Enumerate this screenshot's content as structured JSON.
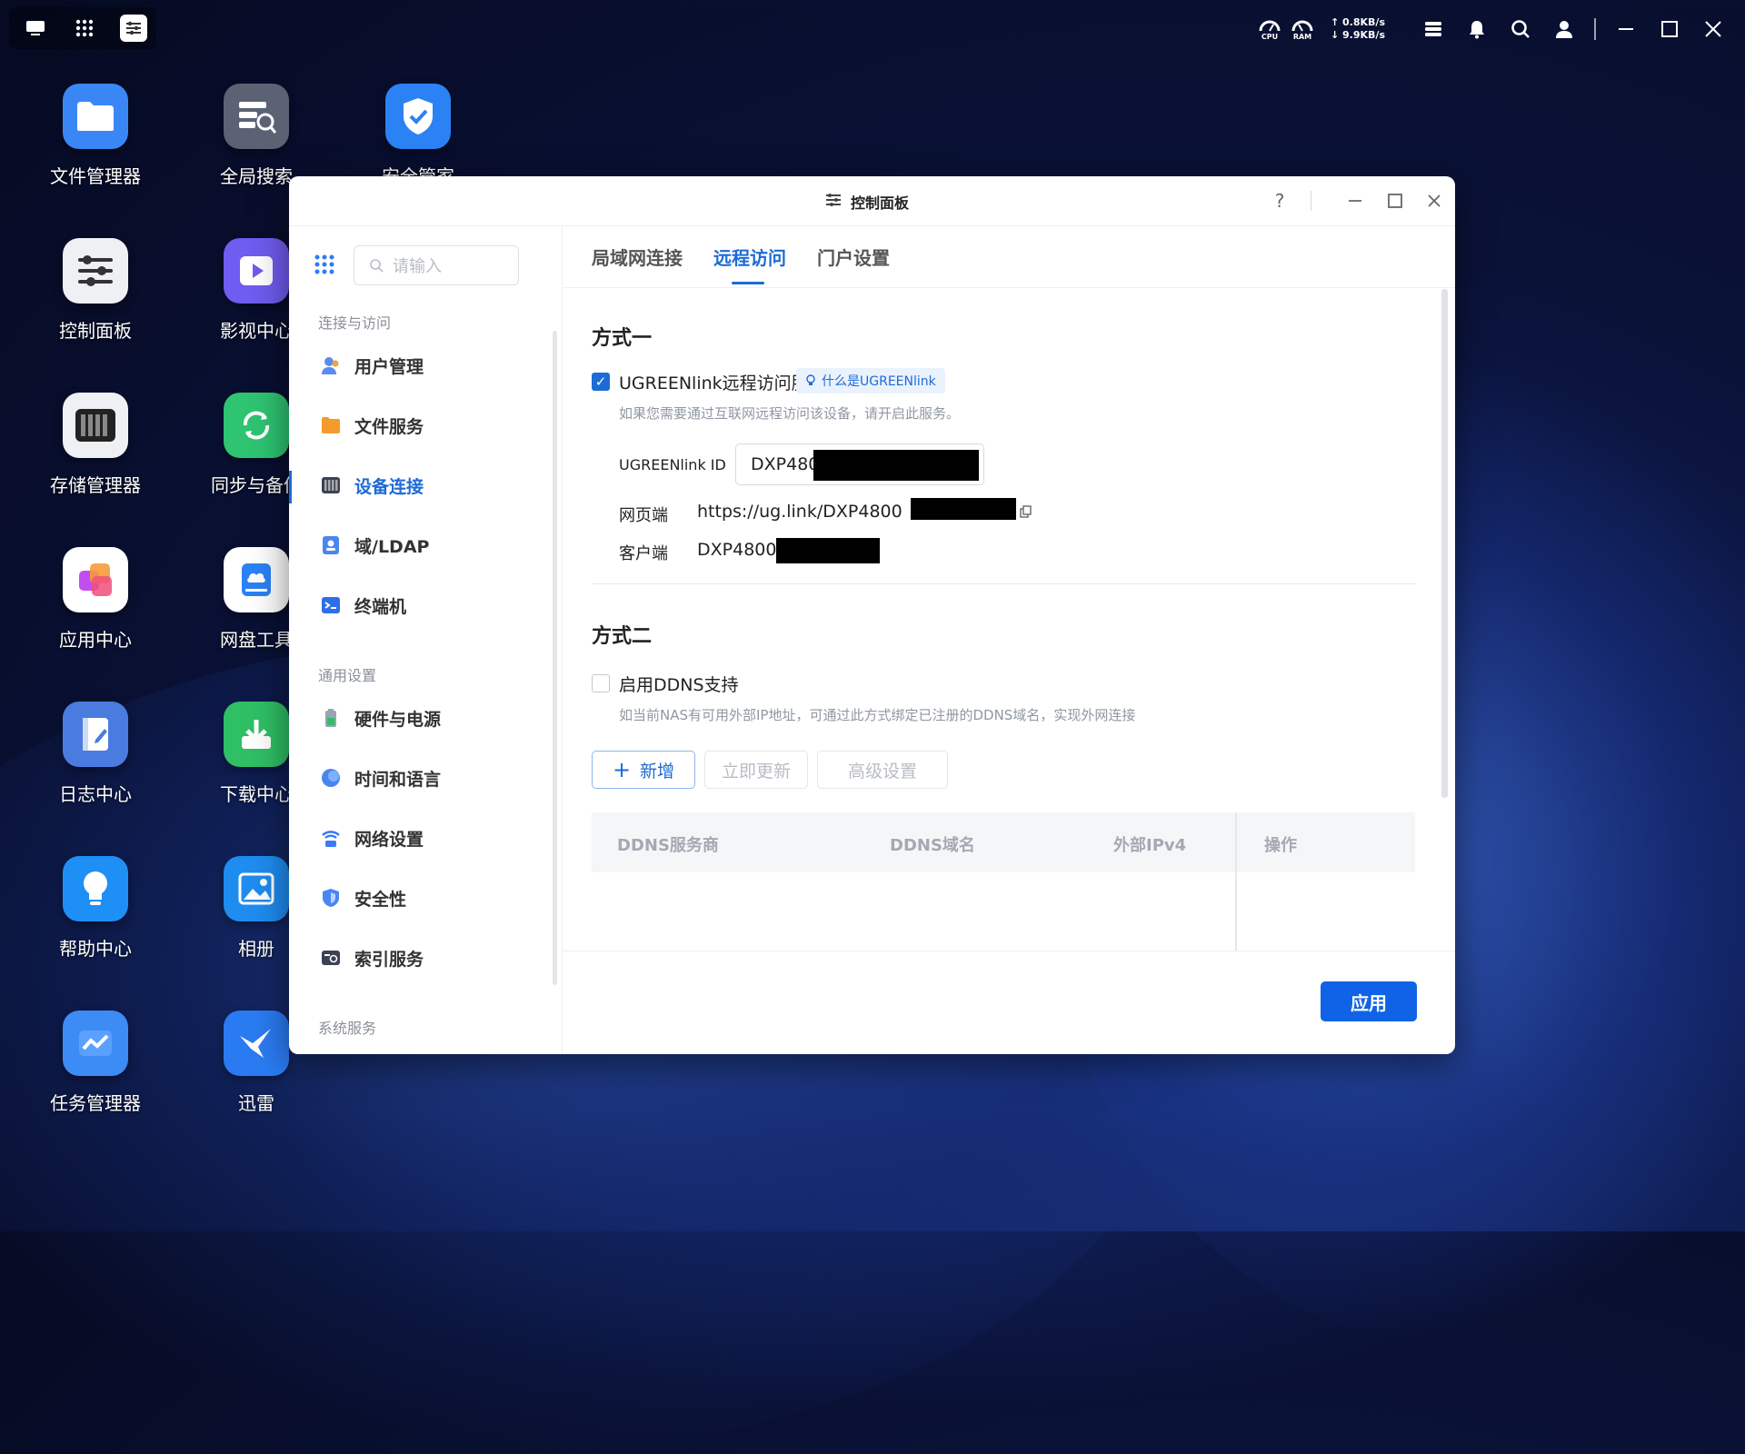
{
  "topbar": {
    "cpu_label": "CPU",
    "ram_label": "RAM",
    "upload_speed": "↑ 0.8KB/s",
    "download_speed": "↓ 9.9KB/s"
  },
  "desktop": {
    "icons": [
      {
        "label": "文件管理器"
      },
      {
        "label": "全局搜索"
      },
      {
        "label": "安全管家"
      },
      {
        "label": "控制面板"
      },
      {
        "label": "影视中心"
      },
      {
        "label": "存储管理器"
      },
      {
        "label": "同步与备份"
      },
      {
        "label": "应用中心"
      },
      {
        "label": "网盘工具"
      },
      {
        "label": "日志中心"
      },
      {
        "label": "下载中心"
      },
      {
        "label": "帮助中心"
      },
      {
        "label": "相册"
      },
      {
        "label": "任务管理器"
      },
      {
        "label": "迅雷"
      }
    ]
  },
  "window": {
    "title": "控制面板",
    "help": "?",
    "search_placeholder": "请输入",
    "sections": {
      "connect": "连接与访问",
      "general": "通用设置",
      "system": "系统服务"
    },
    "nav": [
      {
        "label": "用户管理"
      },
      {
        "label": "文件服务"
      },
      {
        "label": "设备连接"
      },
      {
        "label": "域/LDAP"
      },
      {
        "label": "终端机"
      },
      {
        "label": "硬件与电源"
      },
      {
        "label": "时间和语言"
      },
      {
        "label": "网络设置"
      },
      {
        "label": "安全性"
      },
      {
        "label": "索引服务"
      }
    ],
    "tabs": [
      {
        "label": "局域网连接"
      },
      {
        "label": "远程访问"
      },
      {
        "label": "门户设置"
      }
    ],
    "method1": {
      "title": "方式一",
      "checkbox_label": "UGREENlink远程访问服务",
      "badge": "什么是UGREENlink",
      "hint": "如果您需要通过互联网远程访问该设备，请开启此服务。",
      "id_label": "UGREENlink ID",
      "id_value": "DXP4800-",
      "web_label": "网页端",
      "web_value": "https://ug.link/DXP4800",
      "client_label": "客户端",
      "client_value": "DXP4800-"
    },
    "method2": {
      "title": "方式二",
      "checkbox_label": "启用DDNS支持",
      "hint": "如当前NAS有可用外部IP地址，可通过此方式绑定已注册的DDNS域名，实现外网连接",
      "btn_add": "新增",
      "btn_update": "立即更新",
      "btn_advanced": "高级设置",
      "table_headers": [
        "DDNS服务商",
        "DDNS域名",
        "外部IPv4",
        "操作"
      ]
    },
    "apply": "应用"
  }
}
